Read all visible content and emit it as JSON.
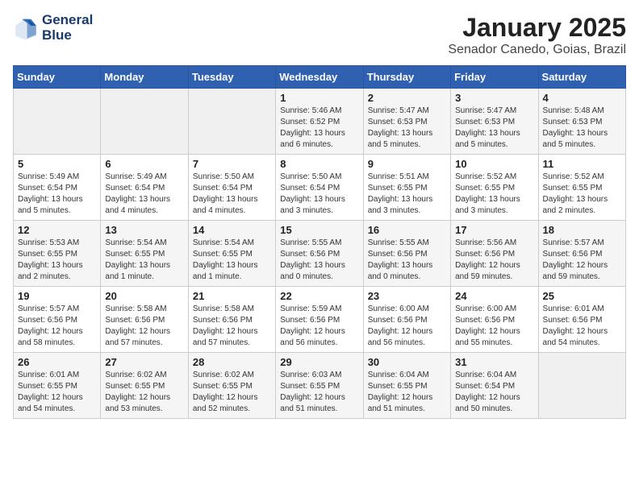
{
  "header": {
    "logo_line1": "General",
    "logo_line2": "Blue",
    "month": "January 2025",
    "location": "Senador Canedo, Goias, Brazil"
  },
  "weekdays": [
    "Sunday",
    "Monday",
    "Tuesday",
    "Wednesday",
    "Thursday",
    "Friday",
    "Saturday"
  ],
  "weeks": [
    [
      {
        "day": "",
        "info": ""
      },
      {
        "day": "",
        "info": ""
      },
      {
        "day": "",
        "info": ""
      },
      {
        "day": "1",
        "info": "Sunrise: 5:46 AM\nSunset: 6:52 PM\nDaylight: 13 hours\nand 6 minutes."
      },
      {
        "day": "2",
        "info": "Sunrise: 5:47 AM\nSunset: 6:53 PM\nDaylight: 13 hours\nand 5 minutes."
      },
      {
        "day": "3",
        "info": "Sunrise: 5:47 AM\nSunset: 6:53 PM\nDaylight: 13 hours\nand 5 minutes."
      },
      {
        "day": "4",
        "info": "Sunrise: 5:48 AM\nSunset: 6:53 PM\nDaylight: 13 hours\nand 5 minutes."
      }
    ],
    [
      {
        "day": "5",
        "info": "Sunrise: 5:49 AM\nSunset: 6:54 PM\nDaylight: 13 hours\nand 5 minutes."
      },
      {
        "day": "6",
        "info": "Sunrise: 5:49 AM\nSunset: 6:54 PM\nDaylight: 13 hours\nand 4 minutes."
      },
      {
        "day": "7",
        "info": "Sunrise: 5:50 AM\nSunset: 6:54 PM\nDaylight: 13 hours\nand 4 minutes."
      },
      {
        "day": "8",
        "info": "Sunrise: 5:50 AM\nSunset: 6:54 PM\nDaylight: 13 hours\nand 3 minutes."
      },
      {
        "day": "9",
        "info": "Sunrise: 5:51 AM\nSunset: 6:55 PM\nDaylight: 13 hours\nand 3 minutes."
      },
      {
        "day": "10",
        "info": "Sunrise: 5:52 AM\nSunset: 6:55 PM\nDaylight: 13 hours\nand 3 minutes."
      },
      {
        "day": "11",
        "info": "Sunrise: 5:52 AM\nSunset: 6:55 PM\nDaylight: 13 hours\nand 2 minutes."
      }
    ],
    [
      {
        "day": "12",
        "info": "Sunrise: 5:53 AM\nSunset: 6:55 PM\nDaylight: 13 hours\nand 2 minutes."
      },
      {
        "day": "13",
        "info": "Sunrise: 5:54 AM\nSunset: 6:55 PM\nDaylight: 13 hours\nand 1 minute."
      },
      {
        "day": "14",
        "info": "Sunrise: 5:54 AM\nSunset: 6:55 PM\nDaylight: 13 hours\nand 1 minute."
      },
      {
        "day": "15",
        "info": "Sunrise: 5:55 AM\nSunset: 6:56 PM\nDaylight: 13 hours\nand 0 minutes."
      },
      {
        "day": "16",
        "info": "Sunrise: 5:55 AM\nSunset: 6:56 PM\nDaylight: 13 hours\nand 0 minutes."
      },
      {
        "day": "17",
        "info": "Sunrise: 5:56 AM\nSunset: 6:56 PM\nDaylight: 12 hours\nand 59 minutes."
      },
      {
        "day": "18",
        "info": "Sunrise: 5:57 AM\nSunset: 6:56 PM\nDaylight: 12 hours\nand 59 minutes."
      }
    ],
    [
      {
        "day": "19",
        "info": "Sunrise: 5:57 AM\nSunset: 6:56 PM\nDaylight: 12 hours\nand 58 minutes."
      },
      {
        "day": "20",
        "info": "Sunrise: 5:58 AM\nSunset: 6:56 PM\nDaylight: 12 hours\nand 57 minutes."
      },
      {
        "day": "21",
        "info": "Sunrise: 5:58 AM\nSunset: 6:56 PM\nDaylight: 12 hours\nand 57 minutes."
      },
      {
        "day": "22",
        "info": "Sunrise: 5:59 AM\nSunset: 6:56 PM\nDaylight: 12 hours\nand 56 minutes."
      },
      {
        "day": "23",
        "info": "Sunrise: 6:00 AM\nSunset: 6:56 PM\nDaylight: 12 hours\nand 56 minutes."
      },
      {
        "day": "24",
        "info": "Sunrise: 6:00 AM\nSunset: 6:56 PM\nDaylight: 12 hours\nand 55 minutes."
      },
      {
        "day": "25",
        "info": "Sunrise: 6:01 AM\nSunset: 6:56 PM\nDaylight: 12 hours\nand 54 minutes."
      }
    ],
    [
      {
        "day": "26",
        "info": "Sunrise: 6:01 AM\nSunset: 6:55 PM\nDaylight: 12 hours\nand 54 minutes."
      },
      {
        "day": "27",
        "info": "Sunrise: 6:02 AM\nSunset: 6:55 PM\nDaylight: 12 hours\nand 53 minutes."
      },
      {
        "day": "28",
        "info": "Sunrise: 6:02 AM\nSunset: 6:55 PM\nDaylight: 12 hours\nand 52 minutes."
      },
      {
        "day": "29",
        "info": "Sunrise: 6:03 AM\nSunset: 6:55 PM\nDaylight: 12 hours\nand 51 minutes."
      },
      {
        "day": "30",
        "info": "Sunrise: 6:04 AM\nSunset: 6:55 PM\nDaylight: 12 hours\nand 51 minutes."
      },
      {
        "day": "31",
        "info": "Sunrise: 6:04 AM\nSunset: 6:54 PM\nDaylight: 12 hours\nand 50 minutes."
      },
      {
        "day": "",
        "info": ""
      }
    ]
  ]
}
